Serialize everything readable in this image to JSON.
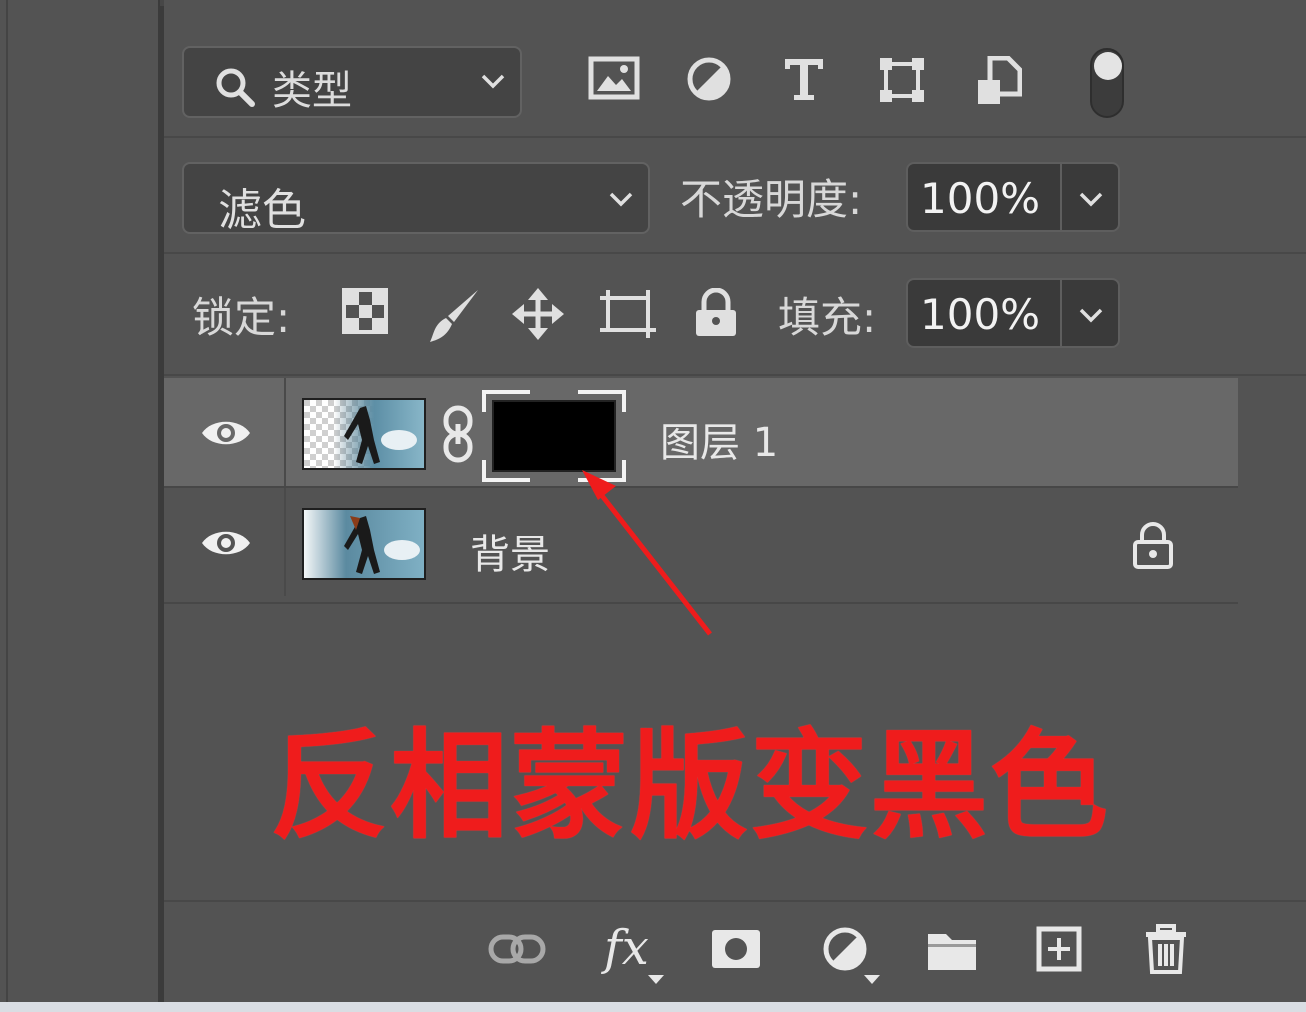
{
  "filter": {
    "label": "类型"
  },
  "blend": {
    "mode": "滤色",
    "opacity_label": "不透明度:",
    "opacity_value": "100%"
  },
  "lock": {
    "label": "锁定:",
    "fill_label": "填充:",
    "fill_value": "100%"
  },
  "layers": [
    {
      "name": "图层 1",
      "selected": true,
      "has_mask": true
    },
    {
      "name": "背景",
      "selected": false,
      "locked": true
    }
  ],
  "annotation": {
    "text": "反相蒙版变黑色",
    "color": "#ef1c1c"
  },
  "bottom_toolbar": {
    "fx_label": "fx"
  },
  "colors": {
    "panel": "#535353",
    "selected_row": "#686868",
    "field_bg": "#3a3a3a",
    "accent_red": "#ef1c1c"
  }
}
